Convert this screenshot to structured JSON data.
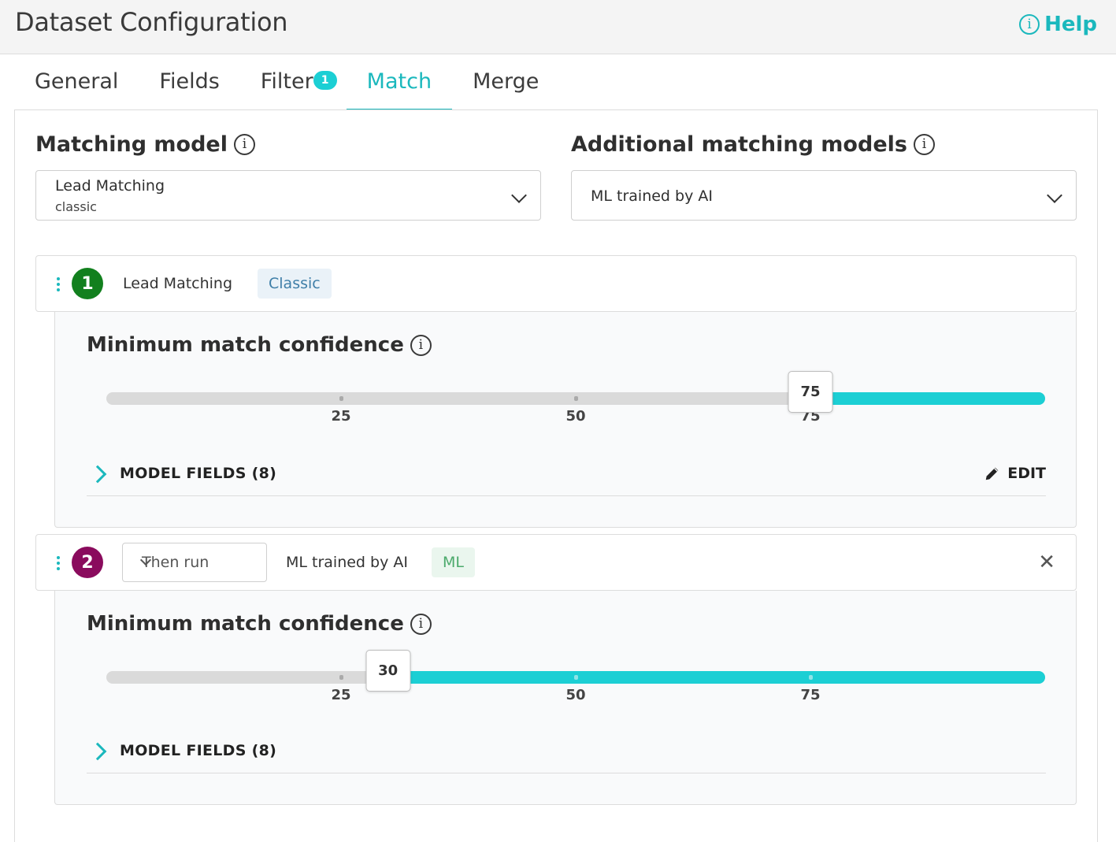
{
  "header": {
    "title": "Dataset Configuration",
    "help_label": "Help",
    "help_icon": "info-circle-icon"
  },
  "tabs": [
    {
      "label": "General",
      "active": false
    },
    {
      "label": "Fields",
      "active": false
    },
    {
      "label": "Filter",
      "active": false,
      "badge": "1"
    },
    {
      "label": "Match",
      "active": true
    },
    {
      "label": "Merge",
      "active": false
    }
  ],
  "matching_model": {
    "title": "Matching model",
    "selected": "Lead Matching",
    "selected_sub": "classic"
  },
  "additional_models": {
    "title": "Additional matching models",
    "selected": "ML trained by AI"
  },
  "models": [
    {
      "number": "1",
      "number_color": "#12801e",
      "name": "Lead Matching",
      "tag": "Classic",
      "tag_bg": "#eaf2f8",
      "tag_color": "#3f7fa8",
      "confidence_title": "Minimum match confidence",
      "confidence_value": "75",
      "confidence_fraction": 0.75,
      "tick_labels": [
        "25",
        "50",
        "75"
      ],
      "fields_label": "MODEL FIELDS (8)",
      "edit_label": "EDIT"
    },
    {
      "number": "2",
      "number_color": "#8a0b5d",
      "run_mode": "Then run",
      "name": "ML trained by AI",
      "tag": "ML",
      "tag_bg": "#eaf6ee",
      "tag_color": "#4caa6c",
      "confidence_title": "Minimum match confidence",
      "confidence_value": "30",
      "confidence_fraction": 0.3,
      "tick_labels": [
        "25",
        "50",
        "75"
      ],
      "fields_label": "MODEL FIELDS (8)"
    }
  ],
  "colors": {
    "accent": "#1bb8bd",
    "slider_fill": "#1ccfd4"
  }
}
